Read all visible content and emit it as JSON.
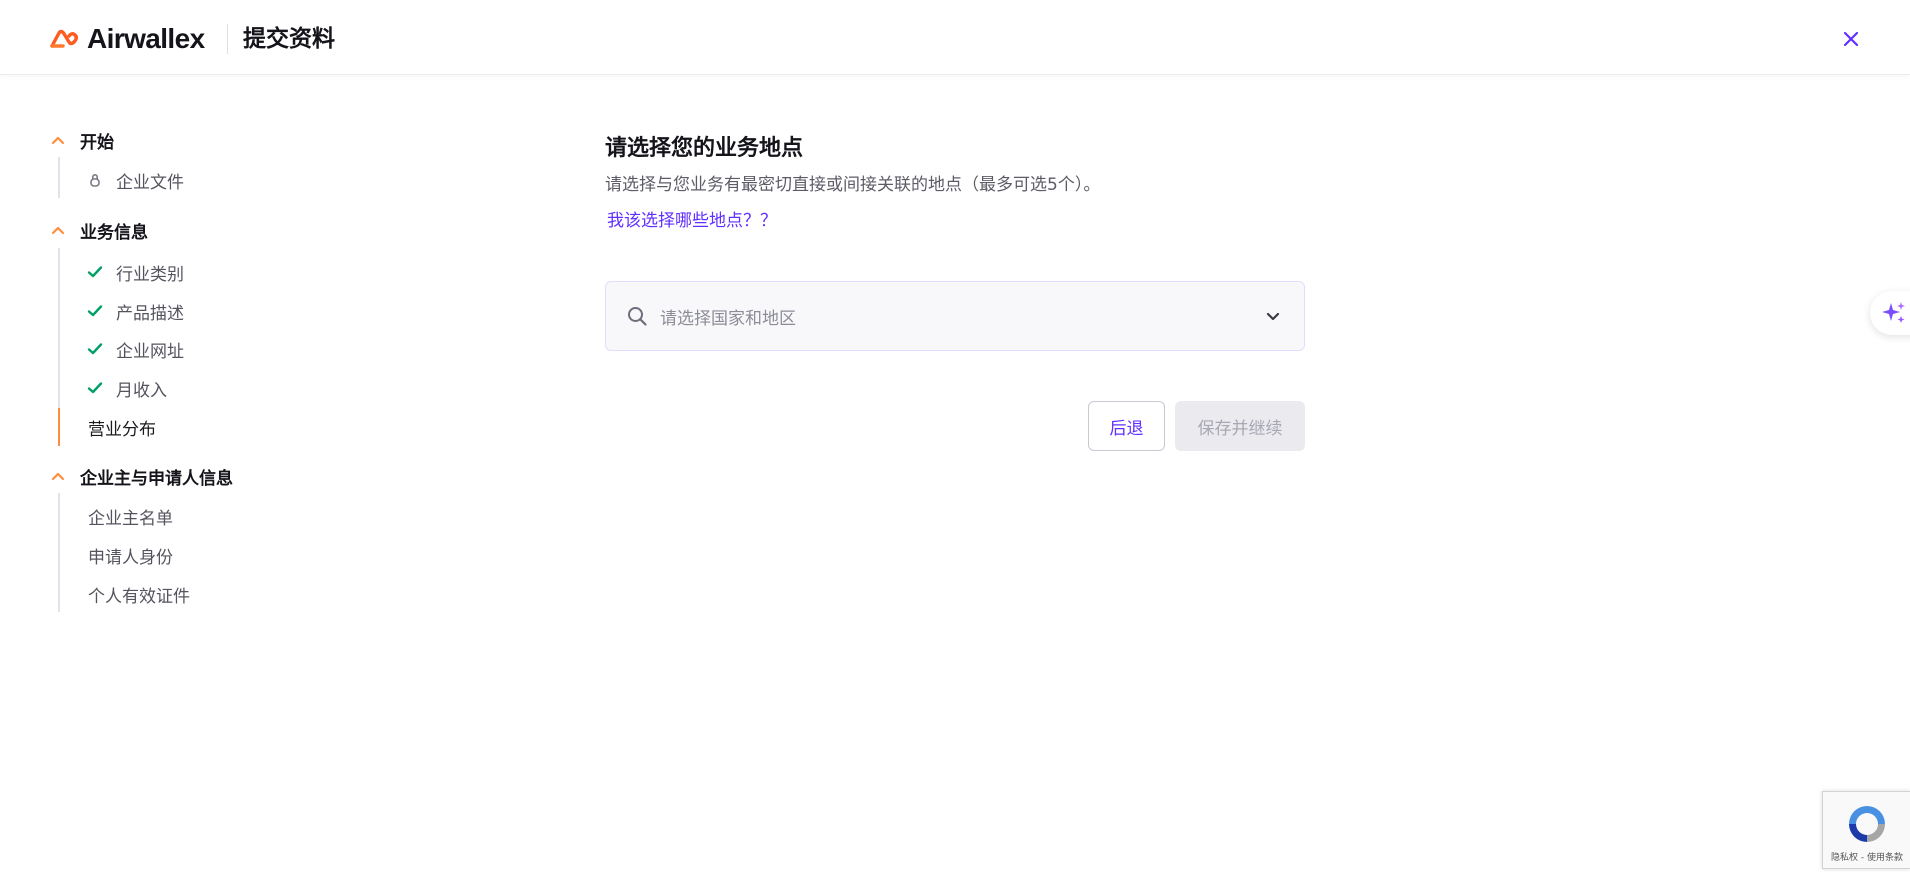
{
  "header": {
    "brand": "Airwallex",
    "title": "提交资料"
  },
  "colors": {
    "accent": "#612fff",
    "brand_orange": "#ff5a1f",
    "success": "#00a064",
    "chevron": "#ff8e3c"
  },
  "sidebar": {
    "sections": [
      {
        "label": "开始",
        "items": [
          {
            "label": "企业文件",
            "state": "locked",
            "icon": "lock-icon"
          }
        ]
      },
      {
        "label": "业务信息",
        "items": [
          {
            "label": "行业类别",
            "state": "done",
            "icon": "check-icon"
          },
          {
            "label": "产品描述",
            "state": "done",
            "icon": "check-icon"
          },
          {
            "label": "企业网址",
            "state": "done",
            "icon": "check-icon"
          },
          {
            "label": "月收入",
            "state": "done",
            "icon": "check-icon"
          },
          {
            "label": "营业分布",
            "state": "active",
            "icon": ""
          }
        ]
      },
      {
        "label": "企业主与申请人信息",
        "items": [
          {
            "label": "企业主名单",
            "state": "pending",
            "icon": ""
          },
          {
            "label": "申请人身份",
            "state": "pending",
            "icon": ""
          },
          {
            "label": "个人有效证件",
            "state": "pending",
            "icon": ""
          }
        ]
      }
    ]
  },
  "main": {
    "title": "请选择您的业务地点",
    "subtitle": "请选择与您业务有最密切直接或间接关联的地点（最多可选5个）。",
    "help_link": "我该选择哪些地点？？",
    "select": {
      "placeholder": "请选择国家和地区"
    },
    "back_label": "后退",
    "save_label": "保存并继续"
  },
  "recaptcha": {
    "text": "隐私权 - 使用条款"
  }
}
